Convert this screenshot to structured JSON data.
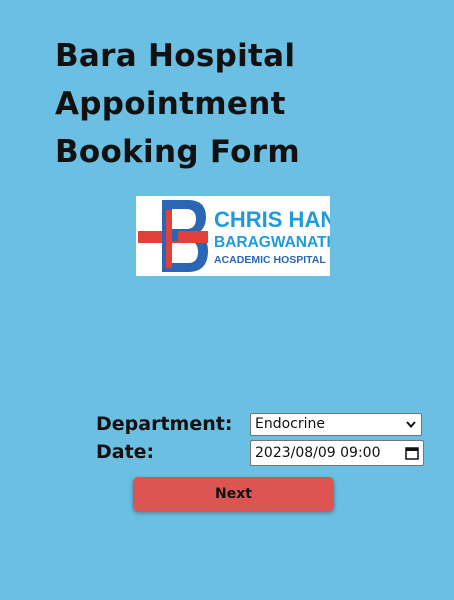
{
  "header": {
    "title_lines": [
      "Bara Hospital",
      "Appointment",
      "Booking Form"
    ]
  },
  "logo": {
    "line1": "CHRIS HANI",
    "line2": "BARAGWANATH",
    "line3": "ACADEMIC HOSPITAL",
    "colors": {
      "red": "#e2413a",
      "blue": "#1f9bdc",
      "dark_blue": "#2a66b4"
    }
  },
  "form": {
    "department_label": "Department:",
    "department_value": "Endocrine",
    "date_label": "Date:",
    "date_value": "2023/08/09 09:00",
    "next_label": "Next"
  },
  "colors": {
    "background": "#6bbfe2",
    "button": "#dd5552"
  }
}
